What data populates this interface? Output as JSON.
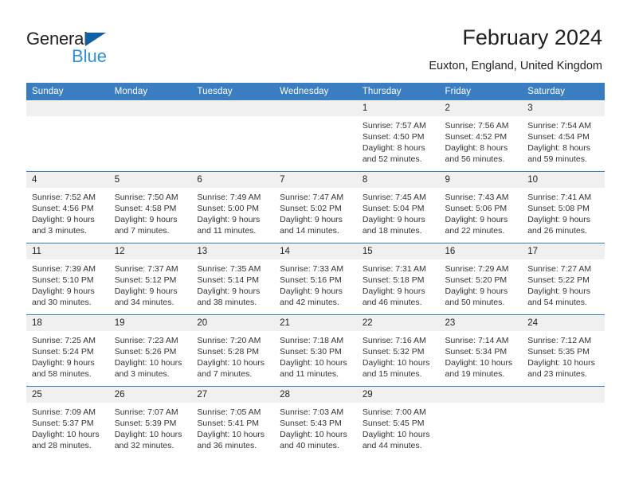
{
  "brand": {
    "name_top": "General",
    "name_bottom": "Blue",
    "triangle_color": "#1060a8",
    "blue_text_color": "#2f8fd8"
  },
  "header": {
    "title": "February 2024",
    "subtitle": "Euxton, England, United Kingdom"
  },
  "theme": {
    "header_blue": "#3a7dc0",
    "daynum_band": "#f0f0f0",
    "text": "#231f20"
  },
  "calendar": {
    "weekday_headers": [
      "Sunday",
      "Monday",
      "Tuesday",
      "Wednesday",
      "Thursday",
      "Friday",
      "Saturday"
    ],
    "weeks": [
      [
        {
          "day": "",
          "empty": true
        },
        {
          "day": "",
          "empty": true
        },
        {
          "day": "",
          "empty": true
        },
        {
          "day": "",
          "empty": true
        },
        {
          "day": "1",
          "sunrise": "Sunrise: 7:57 AM",
          "sunset": "Sunset: 4:50 PM",
          "daylight": "Daylight: 8 hours and 52 minutes."
        },
        {
          "day": "2",
          "sunrise": "Sunrise: 7:56 AM",
          "sunset": "Sunset: 4:52 PM",
          "daylight": "Daylight: 8 hours and 56 minutes."
        },
        {
          "day": "3",
          "sunrise": "Sunrise: 7:54 AM",
          "sunset": "Sunset: 4:54 PM",
          "daylight": "Daylight: 8 hours and 59 minutes."
        }
      ],
      [
        {
          "day": "4",
          "sunrise": "Sunrise: 7:52 AM",
          "sunset": "Sunset: 4:56 PM",
          "daylight": "Daylight: 9 hours and 3 minutes."
        },
        {
          "day": "5",
          "sunrise": "Sunrise: 7:50 AM",
          "sunset": "Sunset: 4:58 PM",
          "daylight": "Daylight: 9 hours and 7 minutes."
        },
        {
          "day": "6",
          "sunrise": "Sunrise: 7:49 AM",
          "sunset": "Sunset: 5:00 PM",
          "daylight": "Daylight: 9 hours and 11 minutes."
        },
        {
          "day": "7",
          "sunrise": "Sunrise: 7:47 AM",
          "sunset": "Sunset: 5:02 PM",
          "daylight": "Daylight: 9 hours and 14 minutes."
        },
        {
          "day": "8",
          "sunrise": "Sunrise: 7:45 AM",
          "sunset": "Sunset: 5:04 PM",
          "daylight": "Daylight: 9 hours and 18 minutes."
        },
        {
          "day": "9",
          "sunrise": "Sunrise: 7:43 AM",
          "sunset": "Sunset: 5:06 PM",
          "daylight": "Daylight: 9 hours and 22 minutes."
        },
        {
          "day": "10",
          "sunrise": "Sunrise: 7:41 AM",
          "sunset": "Sunset: 5:08 PM",
          "daylight": "Daylight: 9 hours and 26 minutes."
        }
      ],
      [
        {
          "day": "11",
          "sunrise": "Sunrise: 7:39 AM",
          "sunset": "Sunset: 5:10 PM",
          "daylight": "Daylight: 9 hours and 30 minutes."
        },
        {
          "day": "12",
          "sunrise": "Sunrise: 7:37 AM",
          "sunset": "Sunset: 5:12 PM",
          "daylight": "Daylight: 9 hours and 34 minutes."
        },
        {
          "day": "13",
          "sunrise": "Sunrise: 7:35 AM",
          "sunset": "Sunset: 5:14 PM",
          "daylight": "Daylight: 9 hours and 38 minutes."
        },
        {
          "day": "14",
          "sunrise": "Sunrise: 7:33 AM",
          "sunset": "Sunset: 5:16 PM",
          "daylight": "Daylight: 9 hours and 42 minutes."
        },
        {
          "day": "15",
          "sunrise": "Sunrise: 7:31 AM",
          "sunset": "Sunset: 5:18 PM",
          "daylight": "Daylight: 9 hours and 46 minutes."
        },
        {
          "day": "16",
          "sunrise": "Sunrise: 7:29 AM",
          "sunset": "Sunset: 5:20 PM",
          "daylight": "Daylight: 9 hours and 50 minutes."
        },
        {
          "day": "17",
          "sunrise": "Sunrise: 7:27 AM",
          "sunset": "Sunset: 5:22 PM",
          "daylight": "Daylight: 9 hours and 54 minutes."
        }
      ],
      [
        {
          "day": "18",
          "sunrise": "Sunrise: 7:25 AM",
          "sunset": "Sunset: 5:24 PM",
          "daylight": "Daylight: 9 hours and 58 minutes."
        },
        {
          "day": "19",
          "sunrise": "Sunrise: 7:23 AM",
          "sunset": "Sunset: 5:26 PM",
          "daylight": "Daylight: 10 hours and 3 minutes."
        },
        {
          "day": "20",
          "sunrise": "Sunrise: 7:20 AM",
          "sunset": "Sunset: 5:28 PM",
          "daylight": "Daylight: 10 hours and 7 minutes."
        },
        {
          "day": "21",
          "sunrise": "Sunrise: 7:18 AM",
          "sunset": "Sunset: 5:30 PM",
          "daylight": "Daylight: 10 hours and 11 minutes."
        },
        {
          "day": "22",
          "sunrise": "Sunrise: 7:16 AM",
          "sunset": "Sunset: 5:32 PM",
          "daylight": "Daylight: 10 hours and 15 minutes."
        },
        {
          "day": "23",
          "sunrise": "Sunrise: 7:14 AM",
          "sunset": "Sunset: 5:34 PM",
          "daylight": "Daylight: 10 hours and 19 minutes."
        },
        {
          "day": "24",
          "sunrise": "Sunrise: 7:12 AM",
          "sunset": "Sunset: 5:35 PM",
          "daylight": "Daylight: 10 hours and 23 minutes."
        }
      ],
      [
        {
          "day": "25",
          "sunrise": "Sunrise: 7:09 AM",
          "sunset": "Sunset: 5:37 PM",
          "daylight": "Daylight: 10 hours and 28 minutes."
        },
        {
          "day": "26",
          "sunrise": "Sunrise: 7:07 AM",
          "sunset": "Sunset: 5:39 PM",
          "daylight": "Daylight: 10 hours and 32 minutes."
        },
        {
          "day": "27",
          "sunrise": "Sunrise: 7:05 AM",
          "sunset": "Sunset: 5:41 PM",
          "daylight": "Daylight: 10 hours and 36 minutes."
        },
        {
          "day": "28",
          "sunrise": "Sunrise: 7:03 AM",
          "sunset": "Sunset: 5:43 PM",
          "daylight": "Daylight: 10 hours and 40 minutes."
        },
        {
          "day": "29",
          "sunrise": "Sunrise: 7:00 AM",
          "sunset": "Sunset: 5:45 PM",
          "daylight": "Daylight: 10 hours and 44 minutes."
        },
        {
          "day": "",
          "empty": true
        },
        {
          "day": "",
          "empty": true
        }
      ]
    ]
  }
}
